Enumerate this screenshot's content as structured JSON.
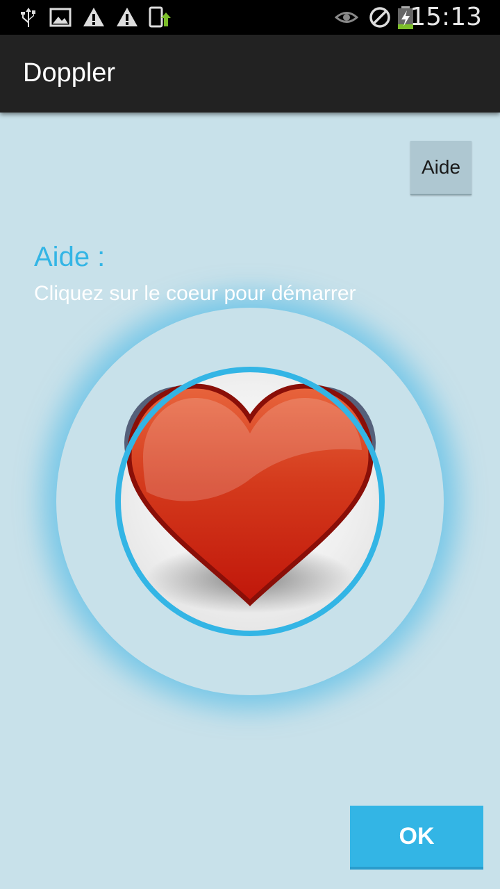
{
  "status_bar": {
    "time": "15:13",
    "icons_left": [
      "usb-icon",
      "image-icon",
      "warning-icon",
      "warning-icon",
      "phone-update-icon"
    ],
    "icons_right": [
      "eye-icon",
      "no-sign-icon",
      "battery-charging-icon"
    ]
  },
  "action_bar": {
    "title": "Doppler"
  },
  "main": {
    "aide_button_label": "Aide",
    "help_title": "Aide :",
    "help_text": "Cliquez sur le coeur pour démarrer",
    "ok_label": "OK"
  },
  "colors": {
    "accent": "#33b5e5",
    "background": "#c8e1ea",
    "action_bar": "#222222",
    "heart": "#cc1a0a"
  }
}
